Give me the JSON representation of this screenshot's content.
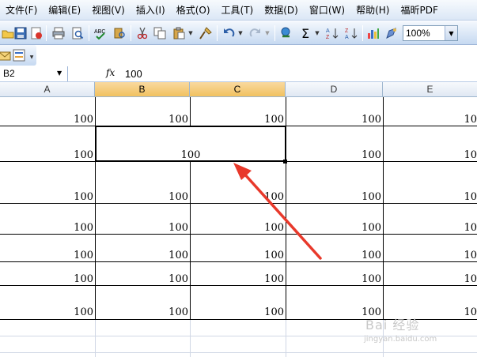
{
  "menu": [
    "文件(F)",
    "编辑(E)",
    "视图(V)",
    "插入(I)",
    "格式(O)",
    "工具(T)",
    "数据(D)",
    "窗口(W)",
    "帮助(H)",
    "福昕PDF"
  ],
  "toolbar": {
    "sigma": "Σ",
    "zoom": "100%"
  },
  "formula_bar": {
    "name_box": "B2",
    "fx": "fx",
    "value": "100"
  },
  "columns": [
    "A",
    "B",
    "C",
    "D",
    "E"
  ],
  "rows": [
    {
      "a": "100",
      "b": "100",
      "c": "100",
      "d": "100",
      "e": "10"
    },
    {
      "a": "100",
      "merged": "100",
      "d": "100",
      "e": "10"
    },
    {
      "a": "100",
      "b": "100",
      "c": "100",
      "d": "100",
      "e": "10"
    },
    {
      "a": "100",
      "b": "100",
      "c": "100",
      "d": "100",
      "e": "10"
    },
    {
      "a": "100",
      "b": "100",
      "c": "100",
      "d": "100",
      "e": "10"
    },
    {
      "a": "100",
      "b": "100",
      "c": "100",
      "d": "100",
      "e": "10"
    },
    {
      "a": "100",
      "b": "100",
      "c": "100",
      "d": "100",
      "e": "10"
    }
  ],
  "watermark": "Bai 经验",
  "watermark_sub": "jingyan.baidu.com",
  "colors": {
    "selected_header": "#f1c15f",
    "arrow": "#e8392b"
  }
}
